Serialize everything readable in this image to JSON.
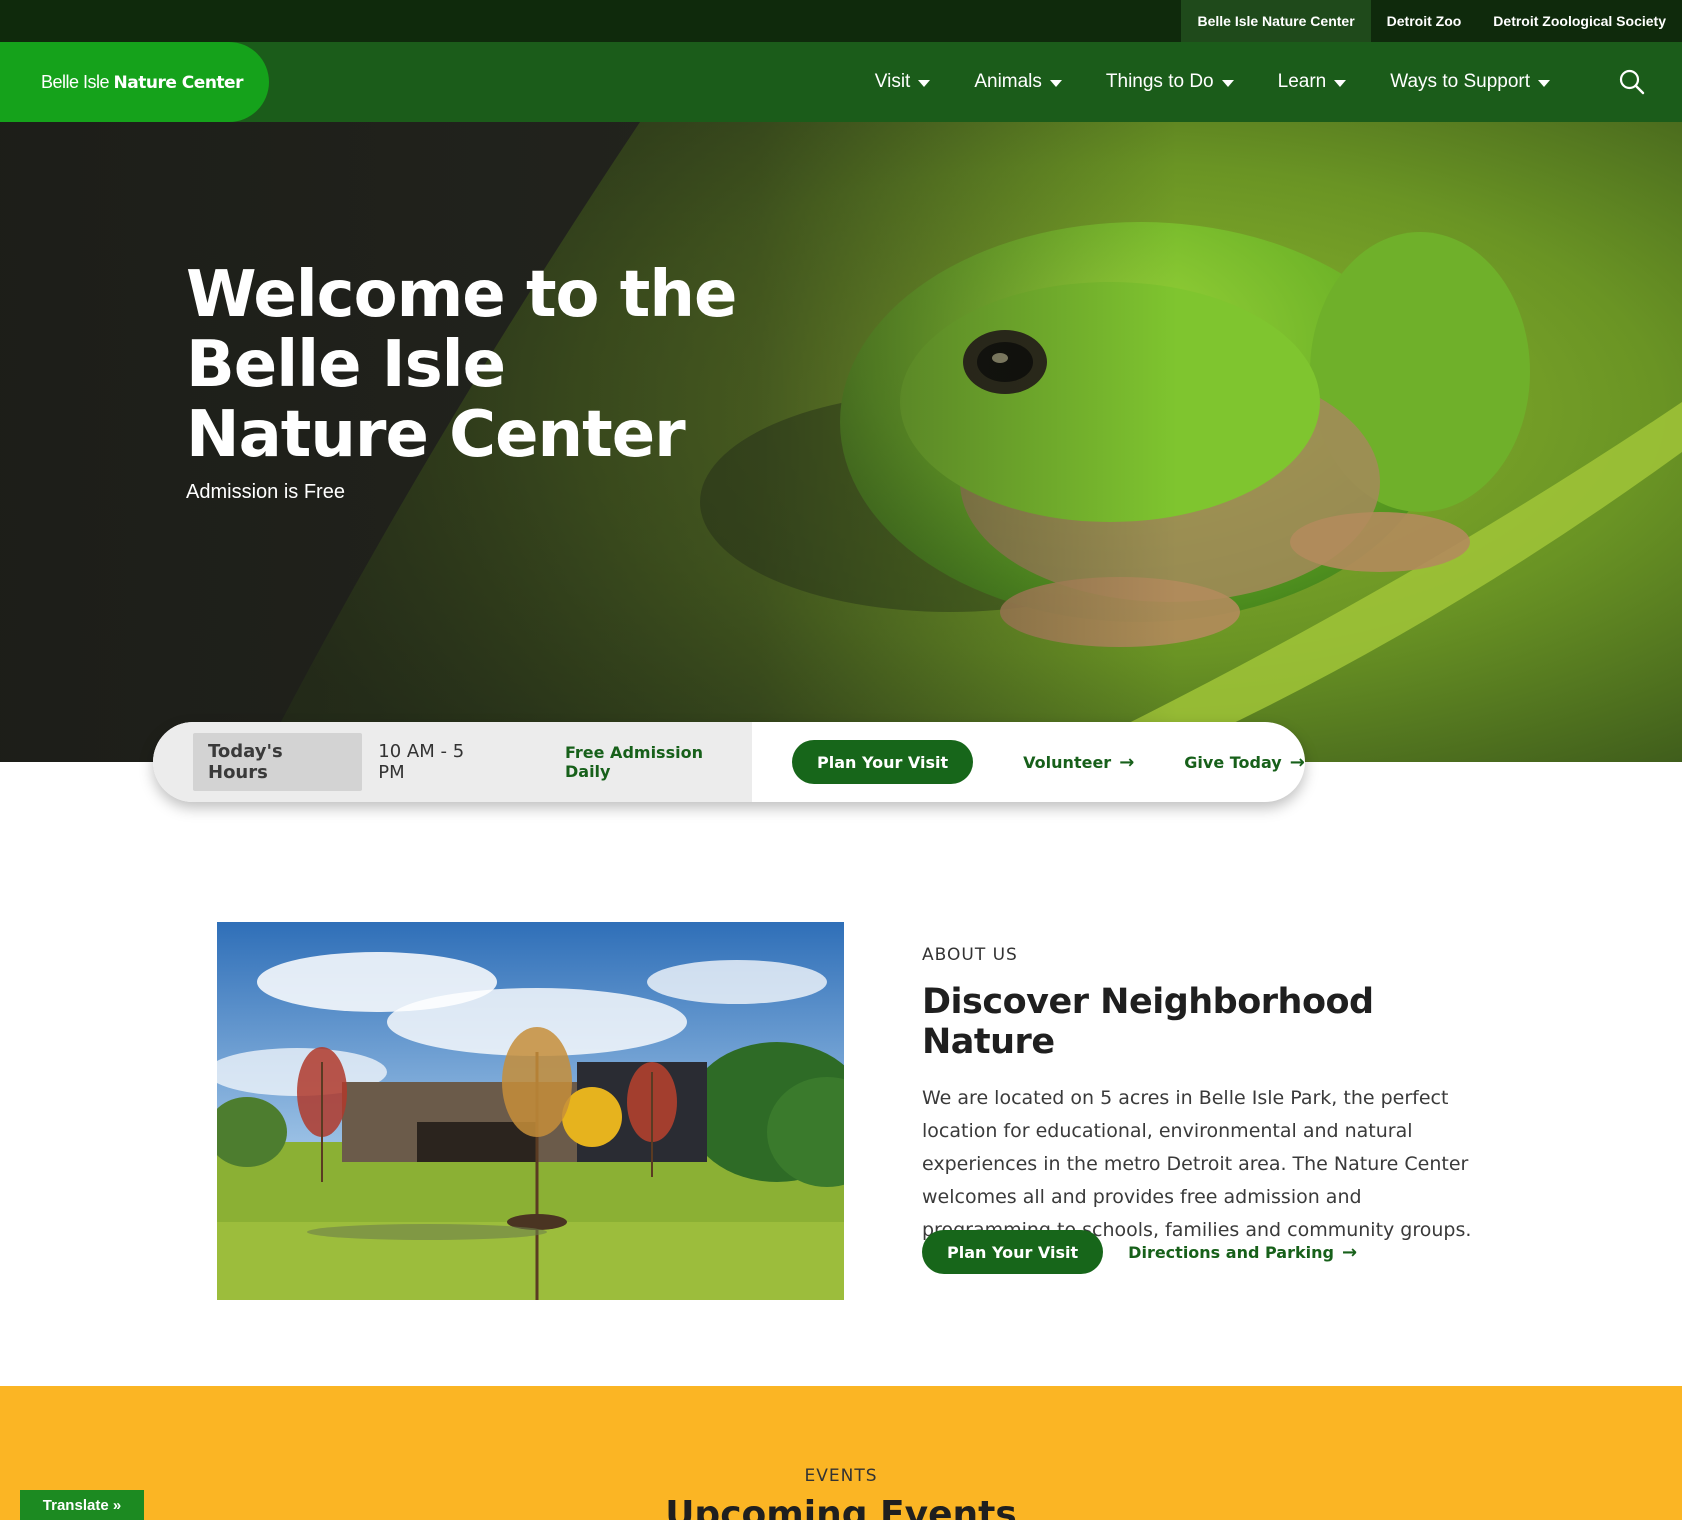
{
  "utility_bar": {
    "links": [
      {
        "label": "Belle Isle Nature Center",
        "active": true
      },
      {
        "label": "Detroit Zoo",
        "active": false
      },
      {
        "label": "Detroit Zoological Society",
        "active": false
      }
    ]
  },
  "header": {
    "logo": {
      "light": "Belle Isle ",
      "heavy": "Nature Center"
    },
    "nav": [
      {
        "label": "Visit"
      },
      {
        "label": "Animals"
      },
      {
        "label": "Things to Do"
      },
      {
        "label": "Learn"
      },
      {
        "label": "Ways to Support"
      }
    ],
    "search_icon": "search-icon"
  },
  "hero": {
    "title": "Welcome to the Belle Isle Nature Center",
    "subtitle": "Admission is Free"
  },
  "info_bar": {
    "hours_label": "Today's Hours",
    "hours_value": "10 AM - 5 PM",
    "free_admission": "Free Admission Daily",
    "plan_button": "Plan Your Visit",
    "volunteer_link": "Volunteer",
    "give_link": "Give Today"
  },
  "about": {
    "eyebrow": "ABOUT US",
    "title": "Discover Neighborhood Nature",
    "body": "We are located on 5 acres in Belle Isle Park, the perfect location for educational, environmental and natural experiences in the metro Detroit area. The Nature Center welcomes all and provides free admission and programming to schools, families and community groups.",
    "plan_button": "Plan Your Visit",
    "directions_link": "Directions and Parking"
  },
  "events": {
    "eyebrow": "EVENTS",
    "title": "Upcoming Events"
  },
  "translate": {
    "label": "Translate »"
  },
  "colors": {
    "utility_bg": "#0f2a0c",
    "nav_bg": "#1b5c1a",
    "logo_bg": "#15a21b",
    "button_green": "#17661a",
    "link_green": "#17601a",
    "events_bg": "#fbb524"
  }
}
